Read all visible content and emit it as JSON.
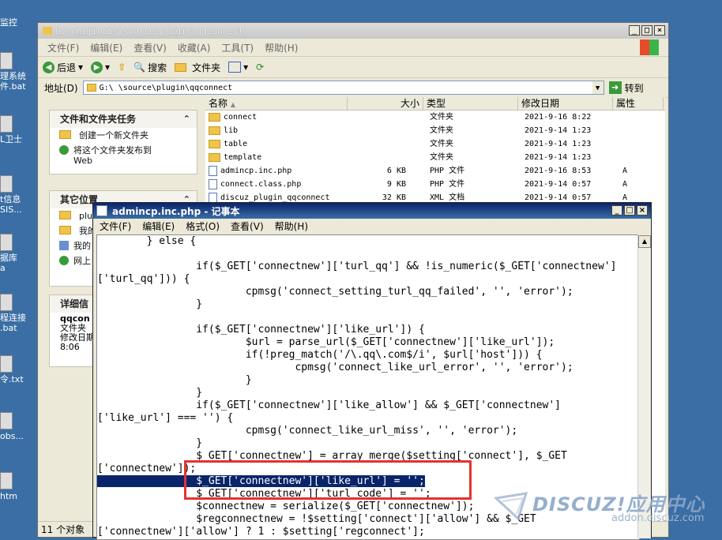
{
  "desktop": {
    "icons": [
      {
        "label": "监控"
      },
      {
        "label": "理系统\n件.bat"
      },
      {
        "label": "L卫士"
      },
      {
        "label": "t信息\nSIS..."
      },
      {
        "label": "据库\na"
      },
      {
        "label": "程连接\n.bat"
      },
      {
        "label": "令.txt"
      },
      {
        "label": "obs..."
      },
      {
        "label": "htm"
      }
    ]
  },
  "explorer": {
    "title": "G:\\chijiobbs\\source\\plugin\\qqconnect",
    "menu": [
      "文件(F)",
      "编辑(E)",
      "查看(V)",
      "收藏(A)",
      "工具(T)",
      "帮助(H)"
    ],
    "toolbar": {
      "back": "后退",
      "search": "搜索",
      "folders": "文件夹"
    },
    "address": {
      "label": "地址(D)",
      "value": "G:\\     \\source\\plugin\\qqconnect",
      "go": "转到"
    },
    "tasks": {
      "title": "文件和文件夹任务",
      "items": [
        "创建一个新文件夹",
        "将这个文件夹发布到\nWeb"
      ]
    },
    "other": {
      "title": "其它位置",
      "items": [
        "plu",
        "我的",
        "我的",
        "网上"
      ]
    },
    "details": {
      "title": "详细信",
      "name": "qqcon",
      "type": "文件夹",
      "modified_label": "修改日期",
      "time": "8:06"
    },
    "columns": [
      "名称",
      "大小",
      "类型",
      "修改日期",
      "属性"
    ],
    "files": [
      {
        "name": "connect",
        "size": "",
        "type": "文件夹",
        "date": "2021-9-16 8:22",
        "attr": "",
        "kind": "folder"
      },
      {
        "name": "lib",
        "size": "",
        "type": "文件夹",
        "date": "2021-9-14 1:23",
        "attr": "",
        "kind": "folder"
      },
      {
        "name": "table",
        "size": "",
        "type": "文件夹",
        "date": "2021-9-14 1:23",
        "attr": "",
        "kind": "folder"
      },
      {
        "name": "template",
        "size": "",
        "type": "文件夹",
        "date": "2021-9-14 1:23",
        "attr": "",
        "kind": "folder"
      },
      {
        "name": "admincp.inc.php",
        "size": "6 KB",
        "type": "PHP 文件",
        "date": "2021-9-16 8:53",
        "attr": "A",
        "kind": "file"
      },
      {
        "name": "connect.class.php",
        "size": "9 KB",
        "type": "PHP 文件",
        "date": "2021-9-14 0:57",
        "attr": "A",
        "kind": "file"
      },
      {
        "name": "discuz_plugin_qqconnect",
        "size": "32 KB",
        "type": "XML 文档",
        "date": "2021-9-14 0:57",
        "attr": "A",
        "kind": "file"
      }
    ],
    "status": "11 个对象"
  },
  "notepad": {
    "title": "admincp.inc.php - 记事本",
    "menu": [
      "文件(F)",
      "编辑(E)",
      "格式(O)",
      "查看(V)",
      "帮助(H)"
    ],
    "lines": [
      "        } else {",
      "",
      "                if($_GET['connectnew']['turl_qq'] && !is_numeric($_GET['connectnew']",
      "['turl_qq'])) {",
      "                        cpmsg('connect_setting_turl_qq_failed', '', 'error');",
      "                }",
      "",
      "                if($_GET['connectnew']['like_url']) {",
      "                        $url = parse_url($_GET['connectnew']['like_url']);",
      "                        if(!preg_match('/\\.qq\\.com$/i', $url['host'])) {",
      "                                cpmsg('connect_like_url_error', '', 'error');",
      "                        }",
      "                }",
      "                if($_GET['connectnew']['like_allow'] && $_GET['connectnew']",
      "['like_url'] === '') {",
      "                        cpmsg('connect_like_url_miss', '', 'error');",
      "                }",
      "                $_GET['connectnew'] = array_merge($setting['connect'], $_GET",
      "['connectnew']);",
      "                $_GET['connectnew']['like_url'] = '';",
      "                $_GET['connectnew']['turl_code'] = '';",
      "                $connectnew = serialize($_GET['connectnew']);",
      "                $regconnectnew = !$setting['connect']['allow'] && $_GET",
      "['connectnew']['allow'] ? 1 : $setting['regconnect'];"
    ],
    "selected_line": 19
  },
  "watermark": {
    "title": "DISCUZ!应用中心",
    "url": "addon.discuz.com"
  },
  "colors": {
    "desktop": "#3a6ea5",
    "selection": "#0a246a",
    "highlight_box": "#e5322d"
  }
}
